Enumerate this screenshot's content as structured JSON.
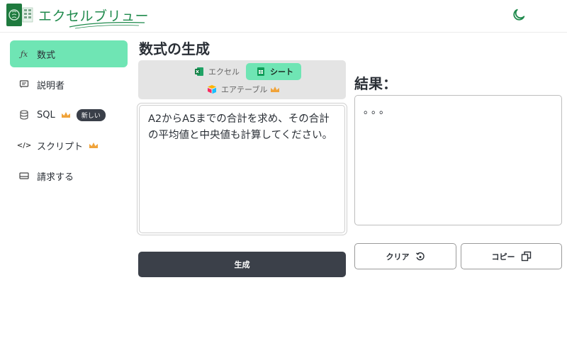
{
  "header": {
    "brand": "エクセルブリュー",
    "logo_icon": "excel-brain-logo-icon",
    "theme_icon": "moon-icon",
    "accent": "#1f8a4c"
  },
  "sidebar": {
    "items": [
      {
        "label": "数式",
        "icon": "fx-icon",
        "active": true
      },
      {
        "label": "説明者",
        "icon": "comment-icon"
      },
      {
        "label": "SQL",
        "icon": "database-icon",
        "premium": true,
        "badge": "新しい"
      },
      {
        "label": "スクリプト",
        "icon": "code-icon",
        "premium": true
      },
      {
        "label": "請求する",
        "icon": "billing-icon"
      }
    ],
    "active_color": "#6fe5b4"
  },
  "main": {
    "title": "数式の生成",
    "tabs": [
      {
        "label": "エクセル",
        "icon": "excel-icon"
      },
      {
        "label": "シート",
        "icon": "sheets-icon",
        "selected": true
      },
      {
        "label": "エアテーブル",
        "icon": "airtable-icon",
        "premium": true
      }
    ],
    "prompt_text": "A2からA5までの合計を求め、その合計の平均値と中央値も計算してください。",
    "generate_label": "生成"
  },
  "result": {
    "title": "結果：",
    "text": "。。。",
    "clear_label": "クリア",
    "copy_label": "コピー"
  }
}
